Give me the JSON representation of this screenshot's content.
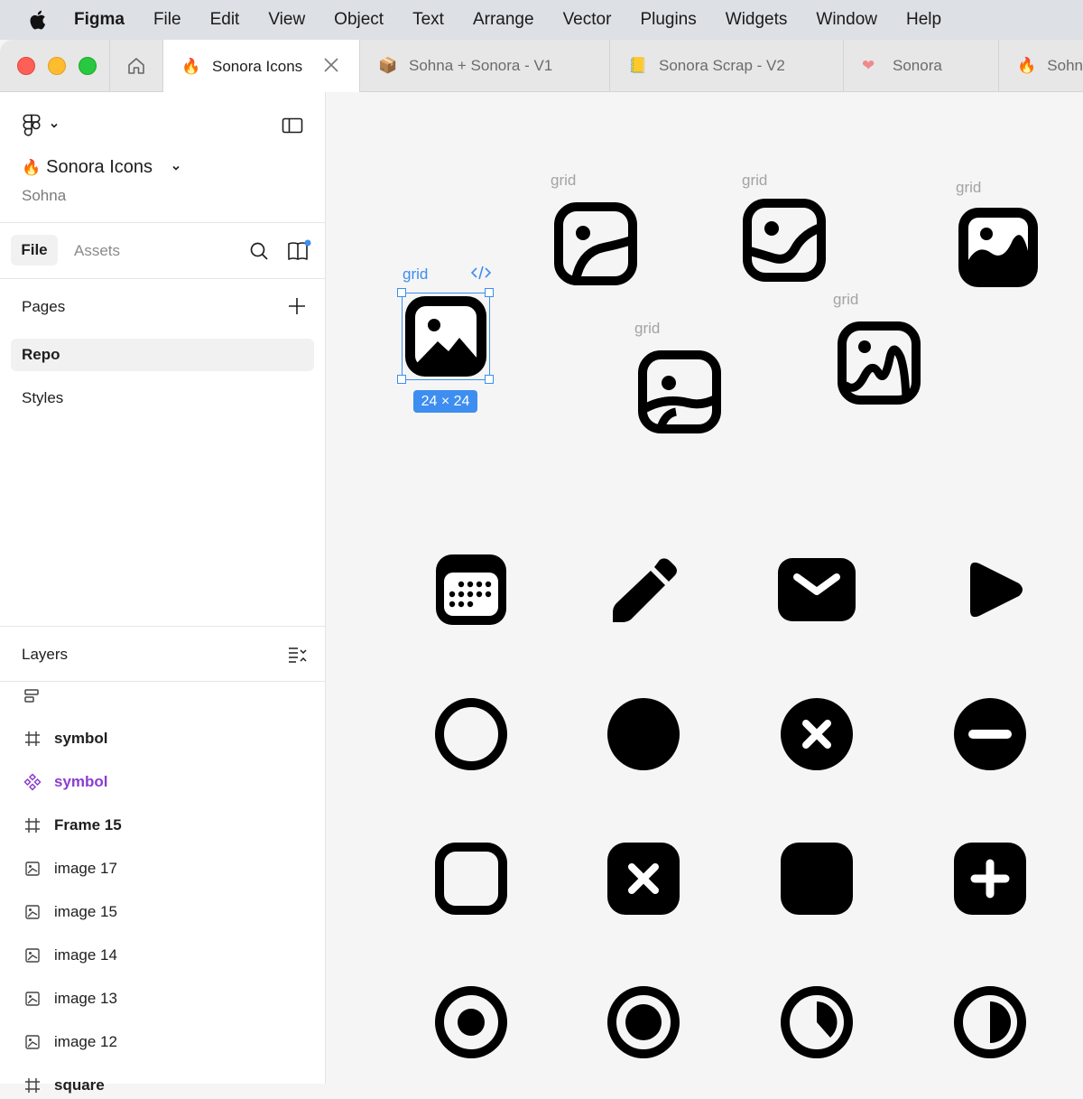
{
  "menubar": {
    "app_name": "Figma",
    "items": [
      "File",
      "Edit",
      "View",
      "Object",
      "Text",
      "Arrange",
      "Vector",
      "Plugins",
      "Widgets",
      "Window",
      "Help"
    ]
  },
  "tabs": [
    {
      "label": "Sonora Icons",
      "icon": "fire-icon",
      "active": true
    },
    {
      "label": "Sohna + Sonora - V1",
      "icon": "box-icon",
      "active": false
    },
    {
      "label": "Sonora Scrap - V2",
      "icon": "note-icon",
      "active": false
    },
    {
      "label": "Sonora",
      "icon": "heart-icon",
      "active": false
    },
    {
      "label": "Sohn",
      "icon": "fire-icon",
      "active": false
    }
  ],
  "sidebar": {
    "project_name": "Sonora Icons",
    "project_emoji": "🔥",
    "team_name": "Sohna",
    "file_tab": "File",
    "assets_tab": "Assets",
    "pages_title": "Pages",
    "pages": [
      {
        "label": "Repo",
        "selected": true
      },
      {
        "label": "Styles",
        "selected": false
      }
    ],
    "layers_title": "Layers",
    "layers": [
      {
        "label": "symbol",
        "type": "frame"
      },
      {
        "label": "symbol",
        "type": "component"
      },
      {
        "label": "Frame 15",
        "type": "frame"
      },
      {
        "label": "image 17",
        "type": "image"
      },
      {
        "label": "image 15",
        "type": "image"
      },
      {
        "label": "image 14",
        "type": "image"
      },
      {
        "label": "image 13",
        "type": "image"
      },
      {
        "label": "image 12",
        "type": "image"
      },
      {
        "label": "square",
        "type": "frame"
      }
    ]
  },
  "canvas": {
    "frame_label": "grid",
    "selection_size": "24 × 24",
    "accent_color": "#3d8ef0"
  }
}
